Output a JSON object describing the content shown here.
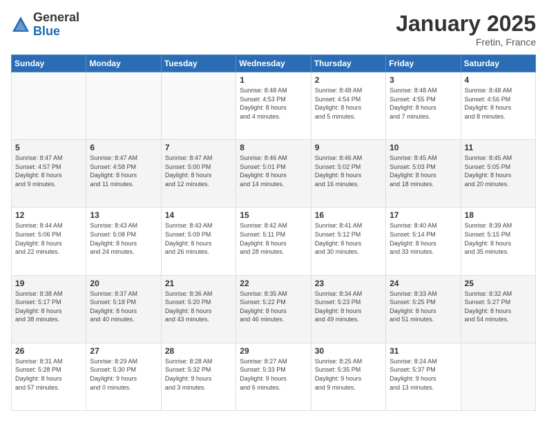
{
  "logo": {
    "general": "General",
    "blue": "Blue"
  },
  "header": {
    "month": "January 2025",
    "location": "Fretin, France"
  },
  "weekdays": [
    "Sunday",
    "Monday",
    "Tuesday",
    "Wednesday",
    "Thursday",
    "Friday",
    "Saturday"
  ],
  "weeks": [
    [
      {
        "day": "",
        "info": ""
      },
      {
        "day": "",
        "info": ""
      },
      {
        "day": "",
        "info": ""
      },
      {
        "day": "1",
        "info": "Sunrise: 8:48 AM\nSunset: 4:53 PM\nDaylight: 8 hours\nand 4 minutes."
      },
      {
        "day": "2",
        "info": "Sunrise: 8:48 AM\nSunset: 4:54 PM\nDaylight: 8 hours\nand 5 minutes."
      },
      {
        "day": "3",
        "info": "Sunrise: 8:48 AM\nSunset: 4:55 PM\nDaylight: 8 hours\nand 7 minutes."
      },
      {
        "day": "4",
        "info": "Sunrise: 8:48 AM\nSunset: 4:56 PM\nDaylight: 8 hours\nand 8 minutes."
      }
    ],
    [
      {
        "day": "5",
        "info": "Sunrise: 8:47 AM\nSunset: 4:57 PM\nDaylight: 8 hours\nand 9 minutes."
      },
      {
        "day": "6",
        "info": "Sunrise: 8:47 AM\nSunset: 4:58 PM\nDaylight: 8 hours\nand 11 minutes."
      },
      {
        "day": "7",
        "info": "Sunrise: 8:47 AM\nSunset: 5:00 PM\nDaylight: 8 hours\nand 12 minutes."
      },
      {
        "day": "8",
        "info": "Sunrise: 8:46 AM\nSunset: 5:01 PM\nDaylight: 8 hours\nand 14 minutes."
      },
      {
        "day": "9",
        "info": "Sunrise: 8:46 AM\nSunset: 5:02 PM\nDaylight: 8 hours\nand 16 minutes."
      },
      {
        "day": "10",
        "info": "Sunrise: 8:45 AM\nSunset: 5:03 PM\nDaylight: 8 hours\nand 18 minutes."
      },
      {
        "day": "11",
        "info": "Sunrise: 8:45 AM\nSunset: 5:05 PM\nDaylight: 8 hours\nand 20 minutes."
      }
    ],
    [
      {
        "day": "12",
        "info": "Sunrise: 8:44 AM\nSunset: 5:06 PM\nDaylight: 8 hours\nand 22 minutes."
      },
      {
        "day": "13",
        "info": "Sunrise: 8:43 AM\nSunset: 5:08 PM\nDaylight: 8 hours\nand 24 minutes."
      },
      {
        "day": "14",
        "info": "Sunrise: 8:43 AM\nSunset: 5:09 PM\nDaylight: 8 hours\nand 26 minutes."
      },
      {
        "day": "15",
        "info": "Sunrise: 8:42 AM\nSunset: 5:11 PM\nDaylight: 8 hours\nand 28 minutes."
      },
      {
        "day": "16",
        "info": "Sunrise: 8:41 AM\nSunset: 5:12 PM\nDaylight: 8 hours\nand 30 minutes."
      },
      {
        "day": "17",
        "info": "Sunrise: 8:40 AM\nSunset: 5:14 PM\nDaylight: 8 hours\nand 33 minutes."
      },
      {
        "day": "18",
        "info": "Sunrise: 8:39 AM\nSunset: 5:15 PM\nDaylight: 8 hours\nand 35 minutes."
      }
    ],
    [
      {
        "day": "19",
        "info": "Sunrise: 8:38 AM\nSunset: 5:17 PM\nDaylight: 8 hours\nand 38 minutes."
      },
      {
        "day": "20",
        "info": "Sunrise: 8:37 AM\nSunset: 5:18 PM\nDaylight: 8 hours\nand 40 minutes."
      },
      {
        "day": "21",
        "info": "Sunrise: 8:36 AM\nSunset: 5:20 PM\nDaylight: 8 hours\nand 43 minutes."
      },
      {
        "day": "22",
        "info": "Sunrise: 8:35 AM\nSunset: 5:22 PM\nDaylight: 8 hours\nand 46 minutes."
      },
      {
        "day": "23",
        "info": "Sunrise: 8:34 AM\nSunset: 5:23 PM\nDaylight: 8 hours\nand 49 minutes."
      },
      {
        "day": "24",
        "info": "Sunrise: 8:33 AM\nSunset: 5:25 PM\nDaylight: 8 hours\nand 51 minutes."
      },
      {
        "day": "25",
        "info": "Sunrise: 8:32 AM\nSunset: 5:27 PM\nDaylight: 8 hours\nand 54 minutes."
      }
    ],
    [
      {
        "day": "26",
        "info": "Sunrise: 8:31 AM\nSunset: 5:28 PM\nDaylight: 8 hours\nand 57 minutes."
      },
      {
        "day": "27",
        "info": "Sunrise: 8:29 AM\nSunset: 5:30 PM\nDaylight: 9 hours\nand 0 minutes."
      },
      {
        "day": "28",
        "info": "Sunrise: 8:28 AM\nSunset: 5:32 PM\nDaylight: 9 hours\nand 3 minutes."
      },
      {
        "day": "29",
        "info": "Sunrise: 8:27 AM\nSunset: 5:33 PM\nDaylight: 9 hours\nand 6 minutes."
      },
      {
        "day": "30",
        "info": "Sunrise: 8:25 AM\nSunset: 5:35 PM\nDaylight: 9 hours\nand 9 minutes."
      },
      {
        "day": "31",
        "info": "Sunrise: 8:24 AM\nSunset: 5:37 PM\nDaylight: 9 hours\nand 13 minutes."
      },
      {
        "day": "",
        "info": ""
      }
    ]
  ]
}
